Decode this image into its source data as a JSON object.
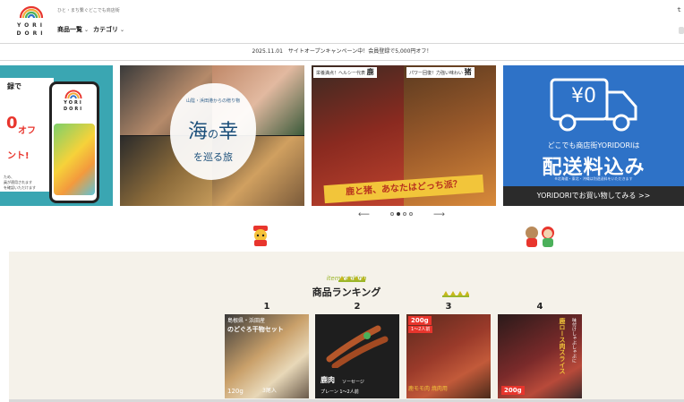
{
  "header": {
    "tagline": "ひと・まち繋ぐどこでも商店街",
    "logo_top": "YORI",
    "logo_bottom": "DORI",
    "nav": [
      {
        "label": "商品一覧"
      },
      {
        "label": "カテゴリ"
      }
    ],
    "corner_glyph": "ｔ"
  },
  "announcement": {
    "date": "2025.11.01",
    "text": "サイトオープンキャンペーン中！会員登録で5,000円オフ！"
  },
  "slides": [
    {
      "text_top": "録で",
      "big_number": "0",
      "big_suffix": "オフ",
      "text_bottom": "ント!",
      "fine_lines": [
        "ため、",
        "員が適用されます",
        "を確認いただけます"
      ],
      "phone_logo_top": "YORI",
      "phone_logo_bottom": "DORI"
    },
    {
      "small": "山陰・浜田港からの贈り物",
      "main": "海",
      "main_no": "の",
      "main2": "幸",
      "sub": "を巡る旅"
    },
    {
      "tag_left_small": "栄養満点！ヘルシー代表",
      "tag_left_big": "鹿",
      "tag_right_small": "パワー回復！力強い味わい",
      "tag_right_big": "猪",
      "banner": "鹿と猪、あなたはどっち派？"
    },
    {
      "yen": "¥0",
      "line1": "どこでも商店街YORIDORIは",
      "line2": "配送料込み",
      "line3": "※北海道・東北・沖縄は別途送料をいただきます",
      "cta": "YORIDORIでお買い物してみる >>"
    }
  ],
  "carousel": {
    "prev_label": "⟵",
    "next_label": "⟶",
    "dot_count": 4,
    "active_dot": 1
  },
  "ranking": {
    "en_title": "item ranking",
    "title": "商品ランキング",
    "items": [
      {
        "rank": "1",
        "caption_top": "島根県・浜田産",
        "caption_mid": "のどぐろ干物セット",
        "caption_bottom": "120g",
        "caption_bottom2": "3尾入"
      },
      {
        "rank": "2",
        "caption_top": "鹿肉",
        "caption_mid": "ソーセージ",
        "caption_bottom": "プレーン 1〜2人前"
      },
      {
        "rank": "3",
        "caption_top": "200g",
        "caption_mid": "1〜2人前",
        "caption_bottom": "鹿モモ肉 焼肉用"
      },
      {
        "rank": "4",
        "caption_top": "味付けしゃぶしゃぶに",
        "caption_mid": "鹿ロース肉スライス",
        "caption_bottom": "200g"
      }
    ]
  },
  "colors": {
    "accent_red": "#e8352d",
    "ranking_bg": "#f5f2ea",
    "truck_blue": "#2e72c7",
    "banner_yellow": "#f2c53a"
  }
}
